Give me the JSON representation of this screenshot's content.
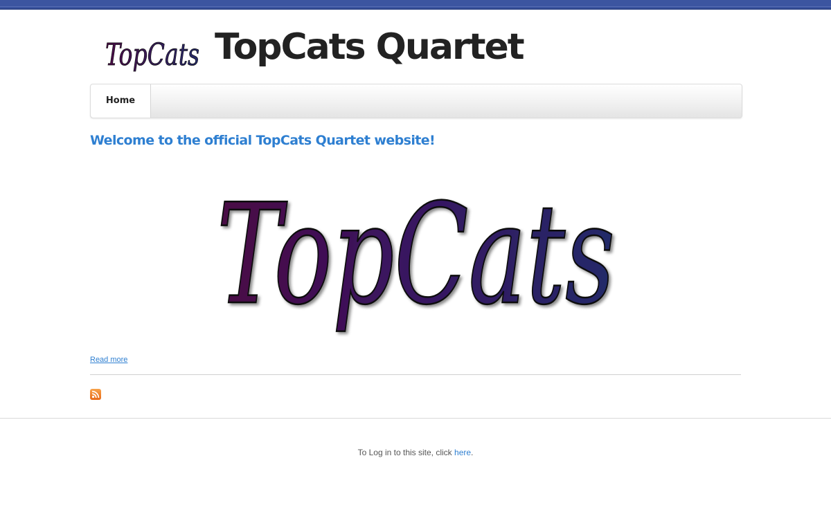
{
  "header": {
    "logo_text": "TopCats",
    "title": "TopCats Quartet"
  },
  "nav": {
    "items": [
      {
        "label": "Home"
      }
    ]
  },
  "main": {
    "heading": "Welcome to the official TopCats Quartet website!",
    "hero_logo_text": "TopCats",
    "read_more": "Read more"
  },
  "footer": {
    "text_prefix": "To Log in to this site, click ",
    "link": "here",
    "text_suffix": "."
  },
  "colors": {
    "top_bar": "#3c55a0",
    "link": "#2e7fd1",
    "logo_purple": "#4a0a44",
    "logo_navy": "#232a68"
  }
}
